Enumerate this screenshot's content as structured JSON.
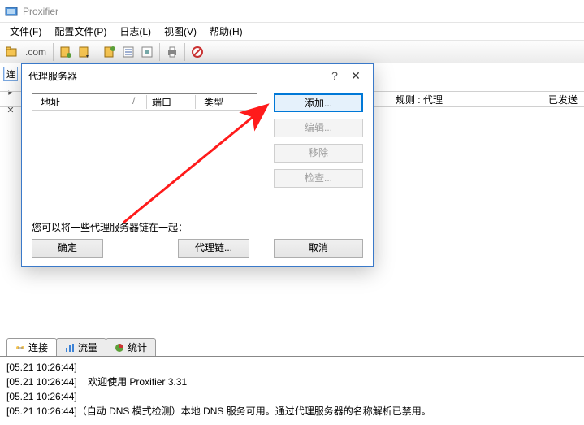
{
  "app": {
    "title": "Proxifier"
  },
  "menu": {
    "file": "文件(F)",
    "profile": "配置文件(P)",
    "log": "日志(L)",
    "view": "视图(V)",
    "help": "帮助(H)"
  },
  "toolbar": {
    "com": ".com"
  },
  "left_sidebar": {
    "connect": "连"
  },
  "main_area": {
    "rules_label": "规则 : 代理",
    "sent_label": "已发送"
  },
  "dialog": {
    "title": "代理服务器",
    "help_symbol": "?",
    "close_symbol": "✕",
    "columns": {
      "address": "地址",
      "port": "端口",
      "type": "类型"
    },
    "buttons": {
      "add": "添加...",
      "edit": "编辑...",
      "remove": "移除",
      "check": "检查...",
      "chain": "代理链...",
      "ok": "确定",
      "cancel": "取消"
    },
    "chain_hint": "您可以将一些代理服务器链在一起："
  },
  "tabs": {
    "connections": "连接",
    "traffic": "流量",
    "stats": "统计"
  },
  "log": {
    "l1": "[05.21 10:26:44]",
    "l2": "[05.21 10:26:44]    欢迎使用 Proxifier 3.31",
    "l3": "[05.21 10:26:44]",
    "l4": "[05.21 10:26:44]（自动 DNS 模式检测）本地 DNS 服务可用。通过代理服务器的名称解析已禁用。"
  }
}
